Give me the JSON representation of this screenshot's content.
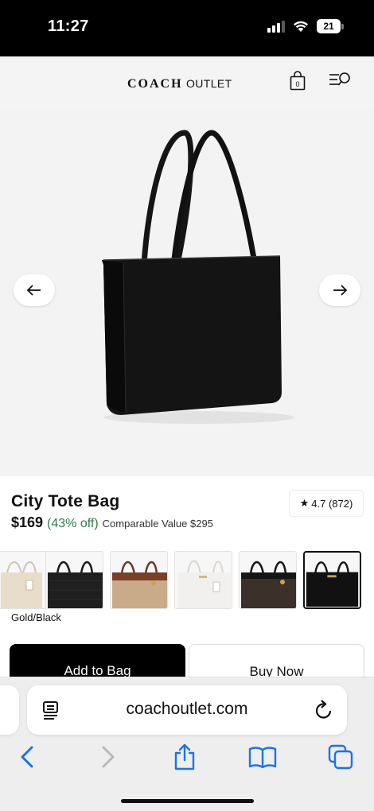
{
  "status_bar": {
    "time": "11:27",
    "battery": "21"
  },
  "header": {
    "brand": "COACH",
    "brand_suffix": "OUTLET",
    "cart_count": "0"
  },
  "gallery": {
    "prev_icon": "arrow-left-icon",
    "next_icon": "arrow-right-icon"
  },
  "product": {
    "title": "City Tote Bag",
    "price": "$169",
    "discount": "(43% off)",
    "comparable": "Comparable Value $295",
    "rating": "4.7 (872)",
    "selected_color": "Gold/Black",
    "discount_color": "#2e7d4f"
  },
  "swatches": [
    {
      "bag": "#e8dccb",
      "pattern": "signature-light"
    },
    {
      "bag": "#1c1c1c",
      "pattern": "signature-dark"
    },
    {
      "bag": "#c9ab8a",
      "pattern": "signature-brown"
    },
    {
      "bag": "#f1f0ee",
      "pattern": "signature-white"
    },
    {
      "bag": "#3b302a",
      "pattern": "signature-brown-black"
    },
    {
      "bag": "#111111",
      "pattern": "solid-black",
      "selected": true
    }
  ],
  "actions": {
    "add_to_bag": "Add to Bag",
    "buy_now": "Buy Now"
  },
  "browser": {
    "url": "coachoutlet.com",
    "accent": "#1a73e8"
  }
}
